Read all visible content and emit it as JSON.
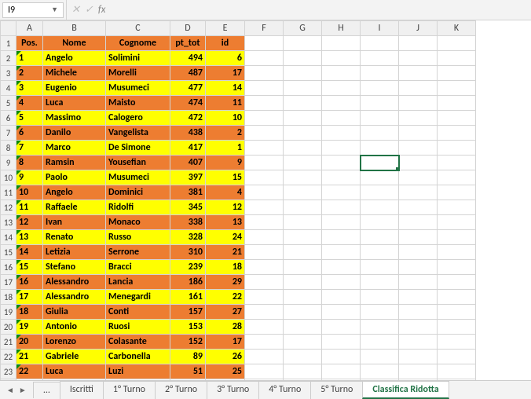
{
  "namebox": {
    "value": "I9"
  },
  "formula_bar": {
    "fx": "fx"
  },
  "columns": [
    "A",
    "B",
    "C",
    "D",
    "E",
    "F",
    "G",
    "H",
    "I",
    "J",
    "K"
  ],
  "header": {
    "pos": "Pos.",
    "nome": "Nome",
    "cognome": "Cognome",
    "pt_tot": "pt_tot",
    "id": "id"
  },
  "rows": [
    {
      "n": "1",
      "pos": "1",
      "nome": "Angelo",
      "cognome": "Solimini",
      "pt": "494",
      "id": "6",
      "c": "yellow"
    },
    {
      "n": "2",
      "pos": "2",
      "nome": "Michele",
      "cognome": "Morelli",
      "pt": "487",
      "id": "17",
      "c": "orange"
    },
    {
      "n": "3",
      "pos": "3",
      "nome": "Eugenio",
      "cognome": "Musumeci",
      "pt": "477",
      "id": "14",
      "c": "yellow"
    },
    {
      "n": "4",
      "pos": "4",
      "nome": "Luca",
      "cognome": "Maisto",
      "pt": "474",
      "id": "11",
      "c": "orange"
    },
    {
      "n": "5",
      "pos": "5",
      "nome": "Massimo",
      "cognome": "Calogero",
      "pt": "472",
      "id": "10",
      "c": "yellow"
    },
    {
      "n": "6",
      "pos": "6",
      "nome": "Danilo",
      "cognome": "Vangelista",
      "pt": "438",
      "id": "2",
      "c": "orange"
    },
    {
      "n": "7",
      "pos": "7",
      "nome": "Marco",
      "cognome": "De Simone",
      "pt": "417",
      "id": "1",
      "c": "yellow"
    },
    {
      "n": "8",
      "pos": "8",
      "nome": "Ramsin",
      "cognome": "Yousefian",
      "pt": "407",
      "id": "9",
      "c": "orange"
    },
    {
      "n": "9",
      "pos": "9",
      "nome": "Paolo",
      "cognome": "Musumeci",
      "pt": "397",
      "id": "15",
      "c": "yellow"
    },
    {
      "n": "10",
      "pos": "10",
      "nome": "Angelo",
      "cognome": "Dominici",
      "pt": "381",
      "id": "4",
      "c": "orange"
    },
    {
      "n": "11",
      "pos": "11",
      "nome": "Raffaele",
      "cognome": "Ridolfi",
      "pt": "345",
      "id": "12",
      "c": "yellow"
    },
    {
      "n": "12",
      "pos": "12",
      "nome": "Ivan",
      "cognome": "Monaco",
      "pt": "338",
      "id": "13",
      "c": "orange"
    },
    {
      "n": "13",
      "pos": "13",
      "nome": "Renato",
      "cognome": "Russo",
      "pt": "328",
      "id": "24",
      "c": "yellow"
    },
    {
      "n": "14",
      "pos": "14",
      "nome": "Letizia",
      "cognome": "Serrone",
      "pt": "310",
      "id": "21",
      "c": "orange"
    },
    {
      "n": "15",
      "pos": "15",
      "nome": "Stefano",
      "cognome": "Bracci",
      "pt": "239",
      "id": "18",
      "c": "yellow"
    },
    {
      "n": "16",
      "pos": "16",
      "nome": "Alessandro",
      "cognome": "Lancia",
      "pt": "186",
      "id": "29",
      "c": "orange"
    },
    {
      "n": "17",
      "pos": "17",
      "nome": "Alessandro",
      "cognome": "Menegardi",
      "pt": "161",
      "id": "22",
      "c": "yellow"
    },
    {
      "n": "18",
      "pos": "18",
      "nome": "Giulia",
      "cognome": "Conti",
      "pt": "157",
      "id": "27",
      "c": "orange"
    },
    {
      "n": "19",
      "pos": "19",
      "nome": "Antonio",
      "cognome": "Ruosi",
      "pt": "153",
      "id": "28",
      "c": "yellow"
    },
    {
      "n": "20",
      "pos": "20",
      "nome": "Lorenzo",
      "cognome": "Colasante",
      "pt": "152",
      "id": "17",
      "c": "orange"
    },
    {
      "n": "21",
      "pos": "21",
      "nome": "Gabriele",
      "cognome": "Carbonella",
      "pt": "89",
      "id": "26",
      "c": "yellow"
    },
    {
      "n": "22",
      "pos": "22",
      "nome": "Luca",
      "cognome": "Luzi",
      "pt": "51",
      "id": "25",
      "c": "orange"
    }
  ],
  "tabs": {
    "ellipsis": "...",
    "items": [
      "Iscritti",
      "1° Turno",
      "2° Turno",
      "3° Turno",
      "4° Turno",
      "5° Turno",
      "Classifica Ridotta"
    ],
    "active": "Classifica Ridotta"
  },
  "chart_data": {
    "type": "table",
    "title": "Classifica Ridotta",
    "columns": [
      "Pos.",
      "Nome",
      "Cognome",
      "pt_tot",
      "id"
    ],
    "rows": [
      [
        1,
        "Angelo",
        "Solimini",
        494,
        6
      ],
      [
        2,
        "Michele",
        "Morelli",
        487,
        17
      ],
      [
        3,
        "Eugenio",
        "Musumeci",
        477,
        14
      ],
      [
        4,
        "Luca",
        "Maisto",
        474,
        11
      ],
      [
        5,
        "Massimo",
        "Calogero",
        472,
        10
      ],
      [
        6,
        "Danilo",
        "Vangelista",
        438,
        2
      ],
      [
        7,
        "Marco",
        "De Simone",
        417,
        1
      ],
      [
        8,
        "Ramsin",
        "Yousefian",
        407,
        9
      ],
      [
        9,
        "Paolo",
        "Musumeci",
        397,
        15
      ],
      [
        10,
        "Angelo",
        "Dominici",
        381,
        4
      ],
      [
        11,
        "Raffaele",
        "Ridolfi",
        345,
        12
      ],
      [
        12,
        "Ivan",
        "Monaco",
        338,
        13
      ],
      [
        13,
        "Renato",
        "Russo",
        328,
        24
      ],
      [
        14,
        "Letizia",
        "Serrone",
        310,
        21
      ],
      [
        15,
        "Stefano",
        "Bracci",
        239,
        18
      ],
      [
        16,
        "Alessandro",
        "Lancia",
        186,
        29
      ],
      [
        17,
        "Alessandro",
        "Menegardi",
        161,
        22
      ],
      [
        18,
        "Giulia",
        "Conti",
        157,
        27
      ],
      [
        19,
        "Antonio",
        "Ruosi",
        153,
        28
      ],
      [
        20,
        "Lorenzo",
        "Colasante",
        152,
        17
      ],
      [
        21,
        "Gabriele",
        "Carbonella",
        89,
        26
      ],
      [
        22,
        "Luca",
        "Luzi",
        51,
        25
      ]
    ]
  }
}
